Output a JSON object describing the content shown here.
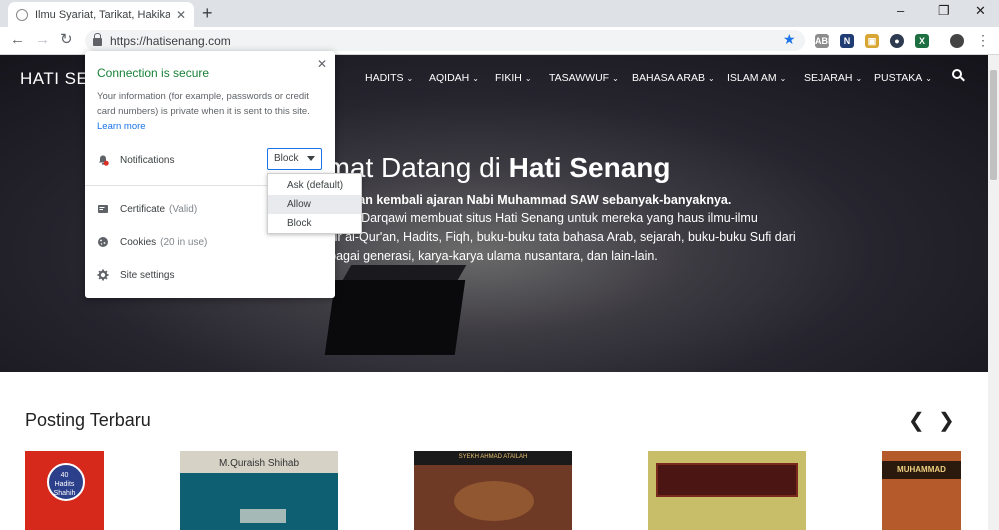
{
  "browser": {
    "tab_title": "Ilmu Syariat, Tarikat, Hakikat dan",
    "tab_close": "✕",
    "new_tab": "+",
    "url": "https://hatisenang.com",
    "minimize": "–",
    "restore": "❐",
    "close": "✕",
    "back": "←",
    "forward": "→",
    "reload": "↻",
    "bookmark_star": "★",
    "menu": "⋮",
    "extensions": [
      {
        "icon": "adblock-icon",
        "label": "ABP",
        "color": "#8c8c8c"
      },
      {
        "icon": "n-extension-icon",
        "label": "N",
        "color": "#1f3c73"
      },
      {
        "icon": "image-extension-icon",
        "label": "▣",
        "color": "#d9a634"
      },
      {
        "icon": "globe-extension-icon",
        "label": "●",
        "color": "#2d3a4f"
      },
      {
        "icon": "excel-extension-icon",
        "label": "X",
        "color": "#1d6f42"
      },
      {
        "icon": "profile-avatar-icon",
        "label": "",
        "color": "#444444"
      }
    ]
  },
  "site": {
    "logo": "HATI SENANG",
    "nav": [
      {
        "label": "HADITS"
      },
      {
        "label": "AQIDAH"
      },
      {
        "label": "FIKIH"
      },
      {
        "label": "TASAWWUF"
      },
      {
        "label": "BAHASA ARAB"
      },
      {
        "label": "ISLAM AM"
      },
      {
        "label": "SEJARAH"
      },
      {
        "label": "PUSTAKA"
      }
    ],
    "hero": {
      "title_prefix": "amat Datang di ",
      "title_bold": "Hati Senang",
      "subtitle": "nyatukan kembali ajaran Nabi Muhammad SAW sebanyak-banyaknya.",
      "lines": [
        "dzili ad-Darqawi membuat situs Hati Senang untuk mereka yang haus ilmu-ilmu",
        "afsir al-Qur'an, Hadits, Fiqh, buku-buku tata bahasa Arab, sejarah, buku-buku Sufi dari",
        "erbagai generasi, karya-karya ulama nusantara, dan lain-lain."
      ]
    },
    "section_title": "Posting Terbaru",
    "prev_arrow": "❮",
    "next_arrow": "❯",
    "books": [
      {
        "caption": "40 Hadits Shahih",
        "color": "#d7281c"
      },
      {
        "caption": "M.Quraish Shihab",
        "color": "#0f5f73"
      },
      {
        "caption": "SYEKH AHMAD ATAILAH",
        "color": "#6e3a25"
      },
      {
        "caption": "",
        "color": "#c8bd68"
      },
      {
        "caption": "MUHAMMAD",
        "color": "#b55a2a"
      }
    ]
  },
  "popup": {
    "close": "✕",
    "title": "Connection is secure",
    "description": "Your information (for example, passwords or credit card numbers) is private when it is sent to this site.",
    "learn_more": "Learn more",
    "notifications_label": "Notifications",
    "notifications_value": "Block",
    "options": [
      "Ask (default)",
      "Allow",
      "Block"
    ],
    "certificate_label": "Certificate",
    "certificate_status": "(Valid)",
    "cookies_label": "Cookies",
    "cookies_status": "(20 in use)",
    "site_settings_label": "Site settings"
  }
}
